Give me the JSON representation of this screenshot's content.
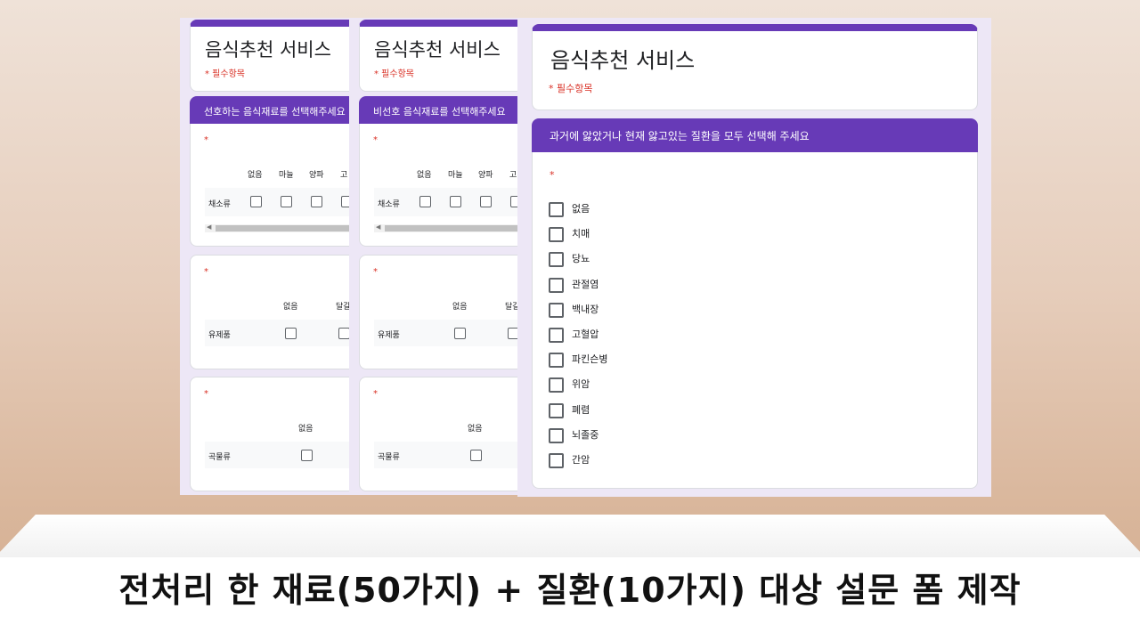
{
  "form_title": "음식추천 서비스",
  "required_note": "* 필수항목",
  "required_star": "*",
  "panel1": {
    "section_title": "선호하는 음식재료를 선택해주세요",
    "q1": {
      "columns": [
        "없음",
        "마늘",
        "양파",
        "고"
      ],
      "row": "채소류"
    },
    "q2": {
      "columns": [
        "없음",
        "달걀"
      ],
      "row": "유제품"
    },
    "q3": {
      "columns": [
        "없음"
      ],
      "row": "곡물류"
    }
  },
  "panel2": {
    "section_title": "비선호 음식재료를 선택해주세요",
    "q1": {
      "columns": [
        "없음",
        "마늘",
        "양파",
        "고"
      ],
      "row": "채소류"
    },
    "q2": {
      "columns": [
        "없음",
        "달걀"
      ],
      "row": "유제품"
    },
    "q3": {
      "columns": [
        "없음"
      ],
      "row": "곡물류"
    }
  },
  "panel3": {
    "section_title": "과거에 앓았거나 현재 앓고있는 질환을 모두 선택해 주세요",
    "options": [
      "없음",
      "치매",
      "당뇨",
      "관절염",
      "백내장",
      "고혈압",
      "파킨슨병",
      "위암",
      "폐렴",
      "뇌졸중",
      "간암"
    ]
  },
  "caption": "전처리 한 재료(50가지) + 질환(10가지) 대상 설문 폼 제작",
  "colors": {
    "accent": "#673ab7",
    "panel_bg": "#ede7f6",
    "required": "#d93025"
  }
}
